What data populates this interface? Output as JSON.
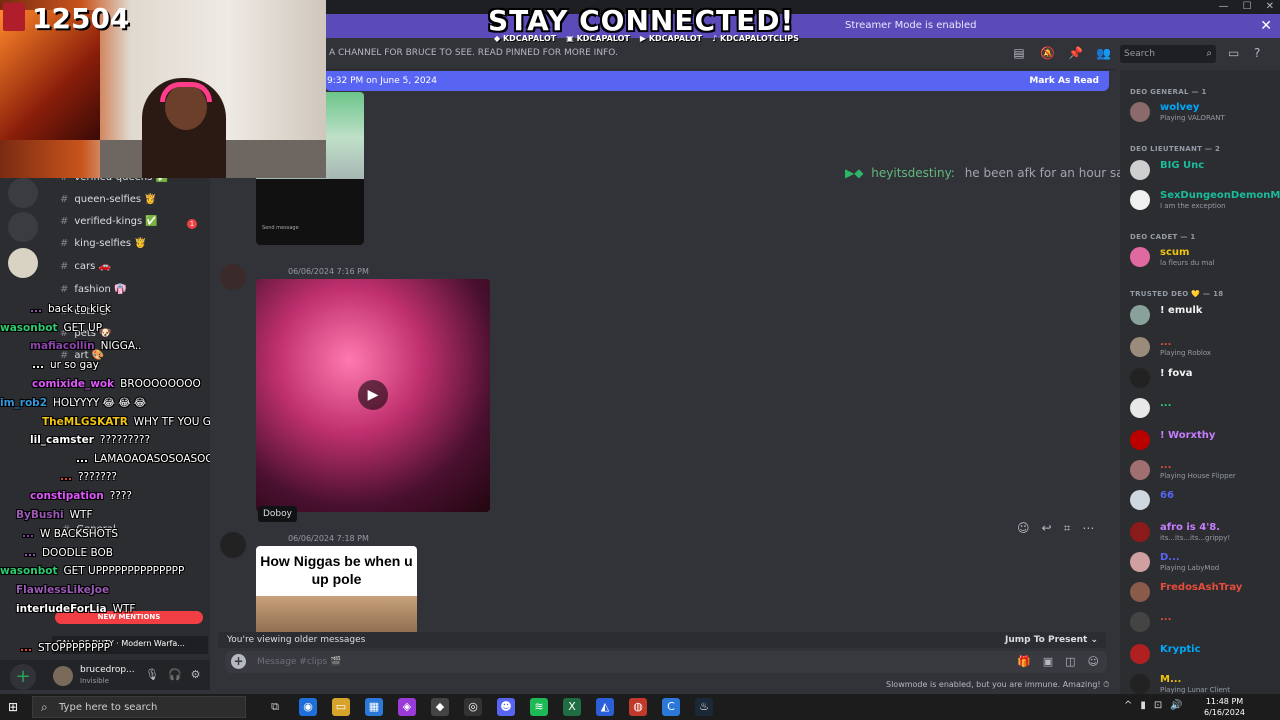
{
  "window": {
    "minimize": "—",
    "maximize": "☐",
    "close": "✕"
  },
  "overlay": {
    "title": "STAY CONNECTED!",
    "socials": [
      "KDCAPALOT",
      "KDCAPALOT",
      "KDCAPALOT",
      "KDCAPALOTCLIPS"
    ],
    "viewer_count": "12504"
  },
  "banner": {
    "text": "Streamer Mode is enabled"
  },
  "channel": {
    "topic": "A CHANNEL FOR BRUCE TO SEE. READ PINNED FOR MORE INFO."
  },
  "search": {
    "placeholder": "Search"
  },
  "new_messages": {
    "since": "9:32 PM on June 5, 2024",
    "action": "Mark As Read"
  },
  "messages": [
    {
      "timestamp": "06/06/2024 7:16 PM"
    },
    {
      "timestamp": "06/06/2024 7:18 PM",
      "meme_text": "How Niggas be when u up pole"
    }
  ],
  "tooltip": "Doboy",
  "afk_message": {
    "user": "heyitsdestiny:",
    "text": "he been afk for an hour save"
  },
  "older_bar": {
    "label": "You're viewing older messages",
    "jump": "Jump To Present"
  },
  "composer": {
    "placeholder": "Message #clips 🎬"
  },
  "slowmode": "Slowmode is enabled, but you are immune. Amazing!",
  "members": {
    "groups": [
      {
        "label": "DEO GENERAL — 1"
      },
      {
        "label": "DEO LIEUTENANT — 2"
      },
      {
        "label": "DEO CADET — 1"
      },
      {
        "label": "TRUSTED DEO 💛 — 18"
      }
    ],
    "list": [
      {
        "name": "wolvey",
        "status": "Playing VALORANT",
        "color": "#00a8fc"
      },
      {
        "name": "BIG Unc",
        "status": "",
        "color": "#1abc9c"
      },
      {
        "name": "SexDungeonDemonM...",
        "status": "I am the exception",
        "color": "#1abc9c"
      },
      {
        "name": "scum",
        "status": "la fleurs du mal",
        "color": "#f1c40f"
      },
      {
        "name": "! emulk",
        "status": "",
        "color": "#f2f3f5"
      },
      {
        "name": "...",
        "status": "Playing Roblox",
        "color": "#e74c3c"
      },
      {
        "name": "! fova",
        "status": "",
        "color": "#f2f3f5"
      },
      {
        "name": "...",
        "status": "",
        "color": "#2ecc71"
      },
      {
        "name": "! Worxthy",
        "status": "",
        "color": "#c77dff"
      },
      {
        "name": "...",
        "status": "Playing House Flipper",
        "color": "#e74c3c"
      },
      {
        "name": "66",
        "status": "",
        "color": "#5865f2"
      },
      {
        "name": "afro is 4'8.",
        "status": "its...its...its...grippy!",
        "color": "#c77dff"
      },
      {
        "name": "D...",
        "status": "Playing LabyMod",
        "color": "#5865f2"
      },
      {
        "name": "FredosAshTray",
        "status": "",
        "color": "#e74c3c"
      },
      {
        "name": "...",
        "status": "",
        "color": "#e74c3c"
      },
      {
        "name": "Kryptic",
        "status": "",
        "color": "#00a8fc"
      },
      {
        "name": "M...",
        "status": "Playing Lunar Client",
        "color": "#f1c40f"
      }
    ]
  },
  "left_channels": [
    {
      "name": "verified-queens ✅"
    },
    {
      "name": "queen-selfies 👸"
    },
    {
      "name": "verified-kings ✅",
      "badge": "1"
    },
    {
      "name": "king-selfies 🤴"
    },
    {
      "name": "cars 🚗"
    },
    {
      "name": "fashion 👘"
    },
    {
      "name": "cats 🐱"
    },
    {
      "name": "pets 🐶"
    },
    {
      "name": "art 🎨"
    },
    {
      "name": "General"
    }
  ],
  "chat": [
    {
      "user": "...",
      "msg": "back to kick",
      "color": "#9b59b6"
    },
    {
      "user": "wasonbot",
      "msg": "GET UP",
      "color": "#2ecc71"
    },
    {
      "user": "mafiacollin",
      "msg": "NIGGA..",
      "color": "#8e44ad"
    },
    {
      "user": "...",
      "msg": "ur so gay",
      "color": "#ffffff"
    },
    {
      "user": "comixide_wok",
      "msg": "BROOOOOOOO",
      "color": "#e056fd"
    },
    {
      "user": "im_rob2",
      "msg": "HOLYYYY 😂 😂 😂",
      "color": "#3498db"
    },
    {
      "user": "TheMLGSKATR",
      "msg": "WHY TF YOU GO SO FAR UP",
      "color": "#f1c40f"
    },
    {
      "user": "lil_camster",
      "msg": "?????????",
      "color": "#ffffff"
    },
    {
      "user": "...",
      "msg": "LAMAOAOASOSOASOOSA",
      "color": "#ffffff"
    },
    {
      "user": "...",
      "msg": "???????",
      "color": "#e74c3c"
    },
    {
      "user": "constipation",
      "msg": "????",
      "color": "#e056fd"
    },
    {
      "user": "ByBushi",
      "msg": "WTF",
      "color": "#9b59b6"
    },
    {
      "user": "...",
      "msg": "W BACKSHOTS",
      "color": "#8e44ad"
    },
    {
      "user": "...",
      "msg": "DOODLE BOB",
      "color": "#9b59b6"
    },
    {
      "user": "wasonbot",
      "msg": "GET UPPPPPPPPPPPPPP",
      "color": "#2ecc71"
    },
    {
      "user": "FlawlessLikeJoe",
      "msg": "",
      "color": "#9b59b6"
    },
    {
      "user": "interludeForLia",
      "msg": "WTF",
      "color": "#ffffff"
    },
    {
      "user": "...",
      "msg": "STOPPPPPPPP",
      "color": "#e74c3c"
    }
  ],
  "new_mentions": "NEW MENTIONS",
  "cod_label": "CALL OF DUTY · Modern Warfa...",
  "user": {
    "name": "brucedrop...",
    "status": "Invisible"
  },
  "taskbar": {
    "search_placeholder": "Type here to search",
    "time": "11:48 PM",
    "date": "6/16/2024"
  }
}
